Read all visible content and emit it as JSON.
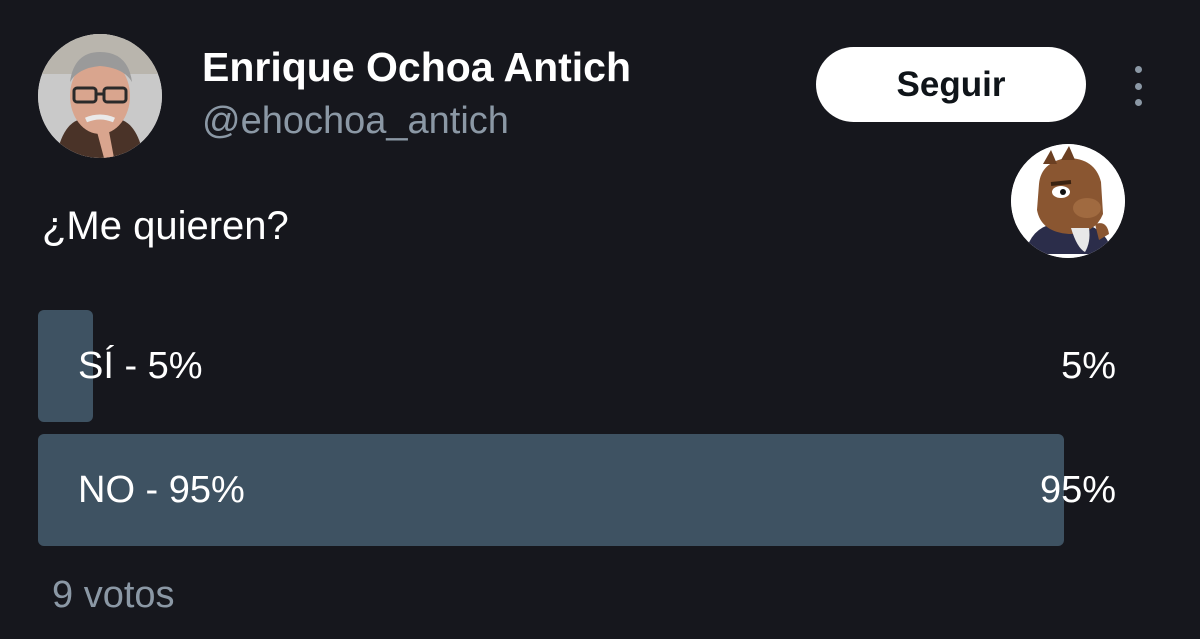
{
  "author": {
    "name": "Enrique Ochoa Antich",
    "handle": "@ehochoa_antich"
  },
  "follow_label": "Seguir",
  "question": "¿Me quieren?",
  "poll": {
    "options": [
      {
        "label": "SÍ - 5%",
        "percent_label": "5%",
        "percent": 5
      },
      {
        "label": "NO - 95%",
        "percent_label": "95%",
        "percent": 95
      }
    ],
    "votes_label": "9 votos"
  },
  "colors": {
    "background": "#16171d",
    "poll_fill": "#3e5262",
    "secondary_text": "#8b98a5"
  }
}
